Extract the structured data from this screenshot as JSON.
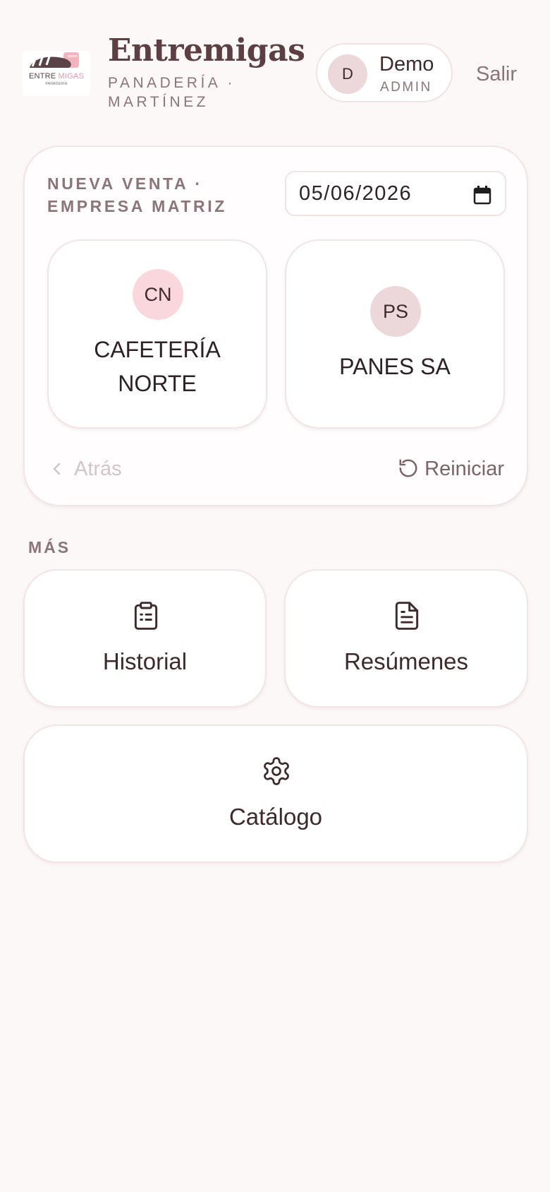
{
  "header": {
    "logo": {
      "word1": "ENTRE",
      "word2": "MIGAS",
      "subtitle": "PANADERÍA",
      "icon": "bread-logo-icon"
    },
    "title": "Entremigas",
    "subtitle": "PANADERÍA · MARTÍNEZ",
    "user": {
      "initial": "D",
      "name": "Demo",
      "role": "ADMIN"
    },
    "logout_label": "Salir"
  },
  "sale": {
    "heading": "NUEVA VENTA · EMPRESA MATRIZ",
    "date_value": "05/06/2026",
    "date_icon": "calendar-icon",
    "clients": [
      {
        "initials": "CN",
        "name": "CAFETERÍA NORTE"
      },
      {
        "initials": "PS",
        "name": "PANES SA"
      }
    ],
    "back_label": "Atrás",
    "back_icon": "chevron-left-icon",
    "reset_label": "Reiniciar",
    "reset_icon": "rotate-ccw-icon"
  },
  "more": {
    "label": "MÁS",
    "tiles": [
      {
        "label": "Historial",
        "icon": "clipboard-list-icon"
      },
      {
        "label": "Resúmenes",
        "icon": "file-text-icon"
      },
      {
        "label": "Catálogo",
        "icon": "gear-icon"
      }
    ]
  },
  "colors": {
    "background": "#fcf8f8",
    "text": "#3e2a2c",
    "muted": "#8c7579",
    "border": "#f3e4e6",
    "avatar_pink": "#f9d7dd",
    "avatar_mauve": "#ecd8db",
    "logo_accent": "#e49aaa"
  }
}
